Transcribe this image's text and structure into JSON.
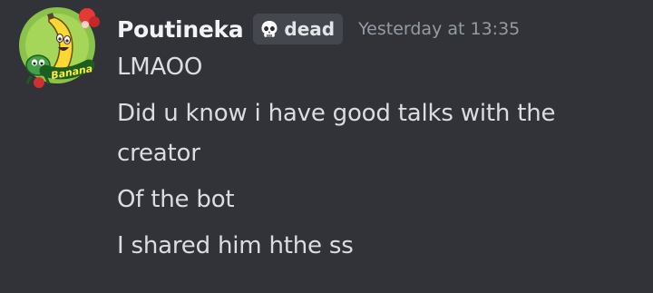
{
  "message": {
    "author": "Poutineka",
    "tag": {
      "icon": "skull-icon",
      "label": "dead"
    },
    "timestamp": "Yesterday at 13:35",
    "avatar": {
      "icon": "banana-avatar-icon",
      "text": "Banana"
    },
    "lines": [
      "LMAOO",
      "Did u know i have good talks with the",
      "creator",
      "Of the bot",
      "I shared him hthe ss"
    ]
  },
  "colors": {
    "background": "#323339",
    "username": "#f2f3f5",
    "body_text": "#dbdee1",
    "timestamp": "#949ba4",
    "tag_background": "#45474e"
  }
}
